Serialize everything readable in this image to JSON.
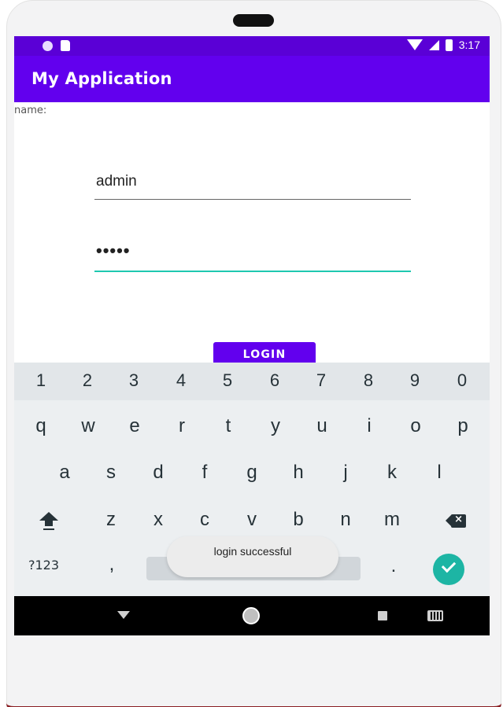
{
  "colors": {
    "primary": "#6200ee",
    "status_bar": "#5a00d6",
    "accent": "#1ec8b0"
  },
  "status_bar": {
    "time": "3:17",
    "icons": [
      "dot-icon",
      "sd-card-icon",
      "wifi-icon",
      "signal-icon",
      "battery-icon"
    ]
  },
  "app_bar": {
    "title": "My Application"
  },
  "form": {
    "name_label": "name:",
    "username_value": "admin",
    "password_value": "•••••",
    "login_label": "LOGIN"
  },
  "keyboard": {
    "number_row": [
      "1",
      "2",
      "3",
      "4",
      "5",
      "6",
      "7",
      "8",
      "9",
      "0"
    ],
    "row1": [
      "q",
      "w",
      "e",
      "r",
      "t",
      "y",
      "u",
      "i",
      "o",
      "p"
    ],
    "row2": [
      "a",
      "s",
      "d",
      "f",
      "g",
      "h",
      "j",
      "k",
      "l"
    ],
    "row3": [
      "z",
      "x",
      "c",
      "v",
      "b",
      "n",
      "m"
    ],
    "symbols_label": "?123",
    "comma": ",",
    "period": "."
  },
  "toast": {
    "message": "login successful"
  },
  "nav_bar": {
    "icons": [
      "back-icon",
      "home-icon",
      "recents-icon",
      "keyboard-switch-icon"
    ]
  }
}
